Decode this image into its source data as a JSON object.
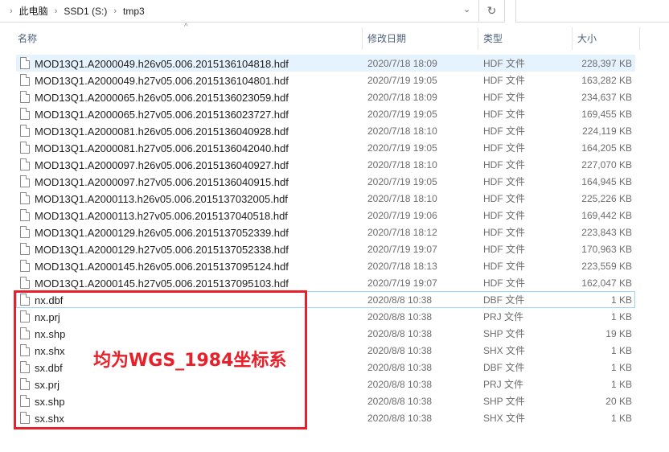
{
  "address": {
    "crumbs": [
      "此电脑",
      "SSD1 (S:)",
      "tmp3"
    ]
  },
  "columns": {
    "name": "名称",
    "date": "修改日期",
    "type": "类型",
    "size": "大小"
  },
  "files": [
    {
      "name": "MOD13Q1.A2000049.h26v05.006.2015136104818.hdf",
      "date": "2020/7/18 18:09",
      "type": "HDF 文件",
      "size": "228,397 KB"
    },
    {
      "name": "MOD13Q1.A2000049.h27v05.006.2015136104801.hdf",
      "date": "2020/7/19 19:05",
      "type": "HDF 文件",
      "size": "163,282 KB"
    },
    {
      "name": "MOD13Q1.A2000065.h26v05.006.2015136023059.hdf",
      "date": "2020/7/18 18:09",
      "type": "HDF 文件",
      "size": "234,637 KB"
    },
    {
      "name": "MOD13Q1.A2000065.h27v05.006.2015136023727.hdf",
      "date": "2020/7/19 19:05",
      "type": "HDF 文件",
      "size": "169,455 KB"
    },
    {
      "name": "MOD13Q1.A2000081.h26v05.006.2015136040928.hdf",
      "date": "2020/7/18 18:10",
      "type": "HDF 文件",
      "size": "224,119 KB"
    },
    {
      "name": "MOD13Q1.A2000081.h27v05.006.2015136042040.hdf",
      "date": "2020/7/19 19:05",
      "type": "HDF 文件",
      "size": "164,205 KB"
    },
    {
      "name": "MOD13Q1.A2000097.h26v05.006.2015136040927.hdf",
      "date": "2020/7/18 18:10",
      "type": "HDF 文件",
      "size": "227,070 KB"
    },
    {
      "name": "MOD13Q1.A2000097.h27v05.006.2015136040915.hdf",
      "date": "2020/7/19 19:05",
      "type": "HDF 文件",
      "size": "164,945 KB"
    },
    {
      "name": "MOD13Q1.A2000113.h26v05.006.2015137032005.hdf",
      "date": "2020/7/18 18:10",
      "type": "HDF 文件",
      "size": "225,226 KB"
    },
    {
      "name": "MOD13Q1.A2000113.h27v05.006.2015137040518.hdf",
      "date": "2020/7/19 19:06",
      "type": "HDF 文件",
      "size": "169,442 KB"
    },
    {
      "name": "MOD13Q1.A2000129.h26v05.006.2015137052339.hdf",
      "date": "2020/7/18 18:12",
      "type": "HDF 文件",
      "size": "223,843 KB"
    },
    {
      "name": "MOD13Q1.A2000129.h27v05.006.2015137052338.hdf",
      "date": "2020/7/19 19:07",
      "type": "HDF 文件",
      "size": "170,963 KB"
    },
    {
      "name": "MOD13Q1.A2000145.h26v05.006.2015137095124.hdf",
      "date": "2020/7/18 18:13",
      "type": "HDF 文件",
      "size": "223,559 KB"
    },
    {
      "name": "MOD13Q1.A2000145.h27v05.006.2015137095103.hdf",
      "date": "2020/7/19 19:07",
      "type": "HDF 文件",
      "size": "162,047 KB"
    },
    {
      "name": "nx.dbf",
      "date": "2020/8/8 10:38",
      "type": "DBF 文件",
      "size": "1 KB"
    },
    {
      "name": "nx.prj",
      "date": "2020/8/8 10:38",
      "type": "PRJ 文件",
      "size": "1 KB"
    },
    {
      "name": "nx.shp",
      "date": "2020/8/8 10:38",
      "type": "SHP 文件",
      "size": "19 KB"
    },
    {
      "name": "nx.shx",
      "date": "2020/8/8 10:38",
      "type": "SHX 文件",
      "size": "1 KB"
    },
    {
      "name": "sx.dbf",
      "date": "2020/8/8 10:38",
      "type": "DBF 文件",
      "size": "1 KB"
    },
    {
      "name": "sx.prj",
      "date": "2020/8/8 10:38",
      "type": "PRJ 文件",
      "size": "1 KB"
    },
    {
      "name": "sx.shp",
      "date": "2020/8/8 10:38",
      "type": "SHP 文件",
      "size": "20 KB"
    },
    {
      "name": "sx.shx",
      "date": "2020/8/8 10:38",
      "type": "SHX 文件",
      "size": "1 KB"
    }
  ],
  "annotation": {
    "text": "均为WGS_1984坐标系",
    "color": "#e8202a"
  }
}
